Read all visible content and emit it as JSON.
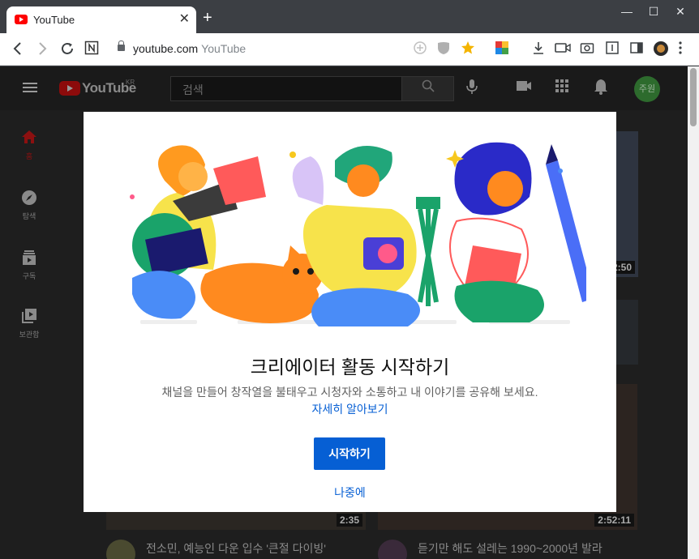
{
  "browser": {
    "tab_title": "YouTube",
    "new_tab": "+",
    "tab_close": "✕",
    "window_controls": {
      "minimize": "—",
      "maximize": "☐",
      "close": "✕"
    },
    "url_host": "youtube.com",
    "url_page_title": "YouTube",
    "icons": [
      "back-icon",
      "forward-icon",
      "reload-icon",
      "notion-icon",
      "lock-icon",
      "add-icon",
      "shield-icon",
      "star-icon",
      "extension-icon",
      "download-icon",
      "video-icon",
      "camera-icon",
      "reader-icon",
      "sidebar-icon",
      "profile-icon",
      "menu-icon"
    ]
  },
  "youtube": {
    "logo_text": "YouTube",
    "logo_region": "KR",
    "search_placeholder": "검색",
    "avatar_text": "주원",
    "sidebar": [
      {
        "label": "홈",
        "icon": "home-icon"
      },
      {
        "label": "탐색",
        "icon": "explore-icon"
      },
      {
        "label": "구독",
        "icon": "subscriptions-icon"
      },
      {
        "label": "보관함",
        "icon": "library-icon"
      }
    ],
    "videos": [
      {
        "duration": "2:50"
      },
      {
        "duration": "2:35",
        "title": "전소민, 예능인 다운 입수 '큰절 다이빙'"
      },
      {
        "duration": "2:52:11",
        "title": "듣기만 해도 설레는 1990~2000년 발라"
      }
    ]
  },
  "modal": {
    "title": "크리에이터 활동 시작하기",
    "description": "채널을 만들어 창작열을 불태우고 시청자와 소통하고 내 이야기를 공유해 보세요.",
    "learn_more": "자세히 알아보기",
    "start_button": "시작하기",
    "later_button": "나중에"
  },
  "colors": {
    "accent_blue": "#065fd4",
    "youtube_red": "#ff0000",
    "overlay_dark": "#1e1e1e"
  }
}
